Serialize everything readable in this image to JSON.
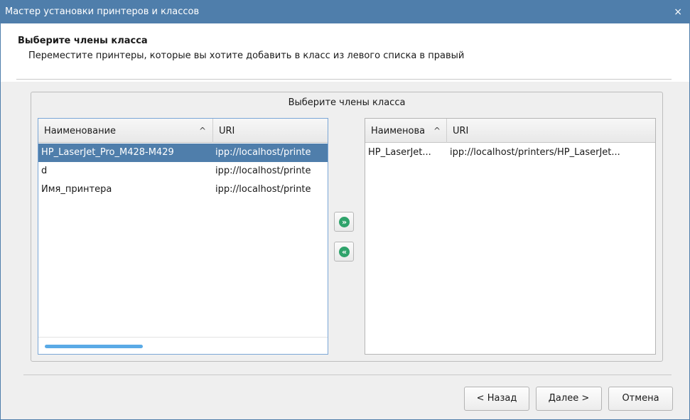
{
  "window": {
    "title": "Мастер установки принтеров и классов",
    "close_glyph": "×"
  },
  "header": {
    "title": "Выберите члены класса",
    "subtitle": "Переместите принтеры, которые вы хотите добавить в класс из левого списка в правый"
  },
  "group": {
    "title": "Выберите члены класса"
  },
  "available": {
    "columns": [
      "Наименование",
      "URI"
    ],
    "sort_glyph": "^",
    "rows": [
      {
        "name": "HP_LaserJet_Pro_M428-M429",
        "uri": "ipp://localhost/printe",
        "selected": true
      },
      {
        "name": "d",
        "uri": "ipp://localhost/printe",
        "selected": false
      },
      {
        "name": "Имя_принтера",
        "uri": "ipp://localhost/printe",
        "selected": false
      }
    ]
  },
  "members": {
    "columns": [
      "Наименова",
      "URI"
    ],
    "sort_glyph": "^",
    "rows": [
      {
        "name": "HP_LaserJet...",
        "uri": "ipp://localhost/printers/HP_LaserJet..."
      }
    ]
  },
  "transfer": {
    "add_glyph": "»",
    "remove_glyph": "«",
    "icon_color": "#2fa36b"
  },
  "buttons": {
    "back": "< Назад",
    "next": "Далее >",
    "cancel": "Отмена"
  },
  "colors": {
    "accent": "#4f7eab",
    "scrollbar": "#5aaae6"
  }
}
